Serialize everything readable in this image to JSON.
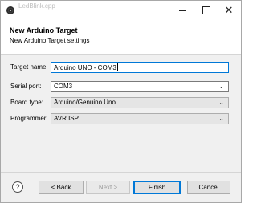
{
  "window": {
    "background_title": "LedBlink.cpp"
  },
  "header": {
    "title": "New Arduino Target",
    "description": "New Arduino Target settings"
  },
  "form": {
    "target_name": {
      "label": "Target name:",
      "value": "Arduino UNO - COM3"
    },
    "serial_port": {
      "label": "Serial port:",
      "value": "COM3"
    },
    "board_type": {
      "label": "Board type:",
      "value": "Arduino/Genuino Uno"
    },
    "programmer": {
      "label": "Programmer:",
      "value": "AVR ISP"
    }
  },
  "buttons": {
    "help": "?",
    "back": "< Back",
    "next": "Next >",
    "finish": "Finish",
    "cancel": "Cancel"
  },
  "colors": {
    "accent": "#0078d7"
  }
}
